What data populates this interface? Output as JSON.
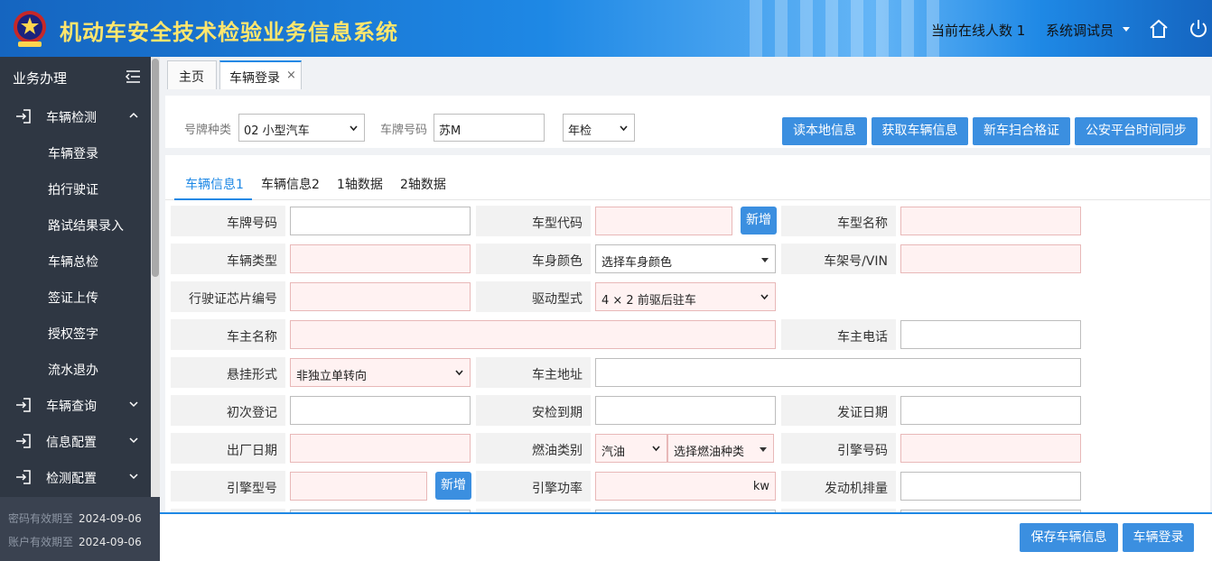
{
  "header": {
    "title": "机动车安全技术检验业务信息系统",
    "online_count": "当前在线人数 1",
    "user": "系统调试员"
  },
  "sidebar": {
    "heading": "业务办理",
    "groups": [
      {
        "label": "车辆检测",
        "expanded": true
      },
      {
        "label": "车辆查询",
        "expanded": false
      },
      {
        "label": "信息配置",
        "expanded": false
      },
      {
        "label": "检测配置",
        "expanded": false
      }
    ],
    "sub_items": [
      "车辆登录",
      "拍行驶证",
      "路试结果录入",
      "车辆总检",
      "签证上传",
      "授权签字",
      "流水退办"
    ],
    "footer": {
      "password_label": "密码有效期至",
      "password_date": "2024-09-06",
      "account_label": "账户有效期至",
      "account_date": "2024-09-06"
    }
  },
  "tabs": [
    {
      "label": "主页",
      "active": false
    },
    {
      "label": "车辆登录",
      "active": true,
      "close": "×"
    }
  ],
  "query": {
    "plate_type_label": "号牌种类",
    "plate_type_value": "02 小型汽车",
    "plate_no_label": "车牌号码",
    "plate_no_value": "苏M",
    "inspection_type_value": "年检",
    "buttons": {
      "read_local": "读本地信息",
      "fetch": "获取车辆信息",
      "scan": "新车扫合格证",
      "sync": "公安平台时间同步"
    }
  },
  "subtabs": [
    "车辆信息1",
    "车辆信息2",
    "1轴数据",
    "2轴数据"
  ],
  "form": {
    "plate_no": "车牌号码",
    "model_code": "车型代码",
    "add_label": "新增",
    "model_name": "车型名称",
    "vehicle_type": "车辆类型",
    "body_color": "车身颜色",
    "body_color_value": "选择车身颜色",
    "vin": "车架号/VIN",
    "license_chip": "行驶证芯片编号",
    "drive_type": "驱动型式",
    "drive_type_value": "4 × 2 前驱后驻车",
    "owner_name": "车主名称",
    "owner_phone": "车主电话",
    "suspension": "悬挂形式",
    "suspension_value": "非独立单转向",
    "owner_address": "车主地址",
    "first_reg": "初次登记",
    "inspection_due": "安检到期",
    "issue_date": "发证日期",
    "factory_date": "出厂日期",
    "fuel_type": "燃油类别",
    "fuel_value": "汽油",
    "fuel_kind_value": "选择燃油种类",
    "engine_no": "引擎号码",
    "engine_model": "引擎型号",
    "engine_power": "引擎功率",
    "power_unit": "kw",
    "displacement": "发动机排量"
  },
  "bottom": {
    "save": "保存车辆信息",
    "login": "车辆登录"
  },
  "colors": {
    "header_blue": "#1565c0",
    "title_yellow": "#ffe66d",
    "sidebar_bg": "#2f3743",
    "button_blue": "#3b8fe0",
    "required_field_bg": "#fff2f2"
  }
}
